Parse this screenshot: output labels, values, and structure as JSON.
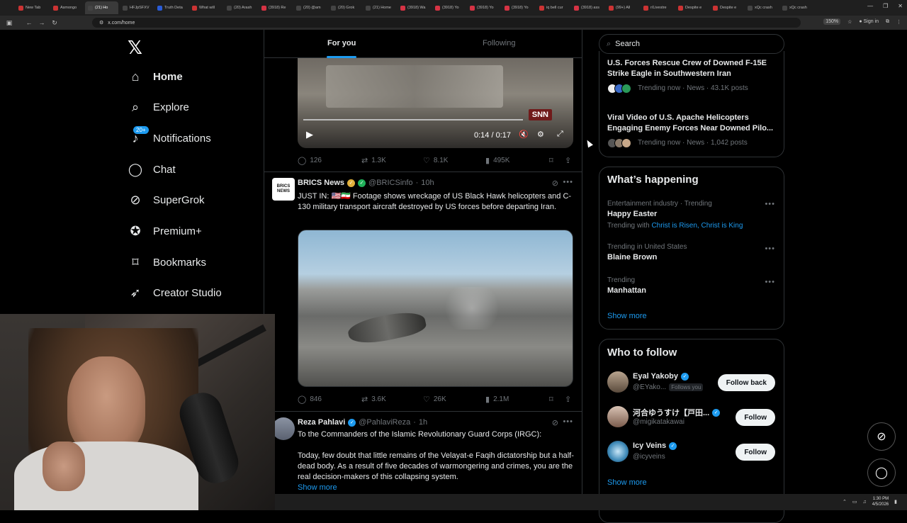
{
  "browser": {
    "tabs": [
      {
        "title": "New Tab"
      },
      {
        "title": "Asmongo"
      },
      {
        "title": "(21) Ho",
        "active": true
      },
      {
        "title": "HFJpSFXV"
      },
      {
        "title": "Truth Deta"
      },
      {
        "title": "What will"
      },
      {
        "title": "(20) Arash"
      },
      {
        "title": "(3918) Re"
      },
      {
        "title": "(20) @am"
      },
      {
        "title": "(20) Grok"
      },
      {
        "title": "(21) Home"
      },
      {
        "title": "(3918) Wa"
      },
      {
        "title": "(3918) Yo"
      },
      {
        "title": "(3918) Yo"
      },
      {
        "title": "(3918) Yo"
      },
      {
        "title": "iq bell cur"
      },
      {
        "title": "(3918) ass"
      },
      {
        "title": "(99+) All"
      },
      {
        "title": "r/Livestre"
      },
      {
        "title": "Despite e"
      },
      {
        "title": "Despite e"
      },
      {
        "title": "xQc crash"
      },
      {
        "title": "xQc crash"
      }
    ],
    "url": "x.com/home",
    "zoom": "150%",
    "sign_in": "Sign in"
  },
  "nav": {
    "items": [
      {
        "label": "Home"
      },
      {
        "label": "Explore"
      },
      {
        "label": "Notifications",
        "badge": "20+"
      },
      {
        "label": "Chat"
      },
      {
        "label": "SuperGrok"
      },
      {
        "label": "Premium+"
      },
      {
        "label": "Bookmarks"
      },
      {
        "label": "Creator Studio"
      }
    ]
  },
  "feed": {
    "tabs": [
      "For you",
      "Following"
    ],
    "video": {
      "time": "0:14 / 0:17",
      "watermark": "SNN"
    },
    "post0_stats": {
      "replies": "126",
      "reposts": "1.3K",
      "likes": "8.1K",
      "views": "495K"
    },
    "post1": {
      "name": "BRICS News",
      "handle": "@BRICSinfo",
      "time": "10h",
      "avatar_text": "BRICS NEWS",
      "text": "JUST IN: 🇺🇸🇮🇷 Footage shows wreckage of US Black Hawk helicopters and C-130 military transport aircraft destroyed by US forces before departing Iran.",
      "stats": {
        "replies": "846",
        "reposts": "3.6K",
        "likes": "26K",
        "views": "2.1M"
      }
    },
    "post2": {
      "name": "Reza Pahlavi",
      "handle": "@PahlaviReza",
      "time": "1h",
      "text_line1": "To the Commanders of the Islamic Revolutionary Guard Corps (IRGC):",
      "text_para": "Today, few doubt that little remains of the Velayat-e Faqih dictatorship but a half-dead body. As a result of five decades of warmongering and crimes, you are the real decision-makers of this collapsing system.",
      "show_more": "Show more"
    }
  },
  "right": {
    "search_placeholder": "Search",
    "news": [
      {
        "title": "U.S. Forces Rescue Crew of Downed F-15E Strike Eagle in Southwestern Iran",
        "meta": "Trending now · News · 43.1K posts"
      },
      {
        "title": "Viral Video of U.S. Apache Helicopters Engaging Enemy Forces Near Downed Pilo...",
        "meta": "Trending now · News · 1,042 posts"
      }
    ],
    "whats_happening": {
      "title": "What’s happening",
      "trends": [
        {
          "context": "Entertainment industry · Trending",
          "name": "Happy Easter",
          "with_label": "Trending with",
          "with_links": "Christ is Risen, Christ is King"
        },
        {
          "context": "Trending in United States",
          "name": "Blaine Brown"
        },
        {
          "context": "Trending",
          "name": "Manhattan"
        }
      ],
      "show_more": "Show more"
    },
    "who_to_follow": {
      "title": "Who to follow",
      "accounts": [
        {
          "name": "Eyal Yakoby",
          "handle": "@EYako...",
          "follows_you": "Follows you",
          "button": "Follow back"
        },
        {
          "name": "河合ゆうすけ【戸田...",
          "handle": "@migikatakawai",
          "button": "Follow"
        },
        {
          "name": "Icy Veins",
          "handle": "@icyveins",
          "button": "Follow"
        }
      ],
      "show_more": "Show more"
    }
  },
  "taskbar": {
    "time": "1:30 PM",
    "date": "4/5/2026"
  }
}
